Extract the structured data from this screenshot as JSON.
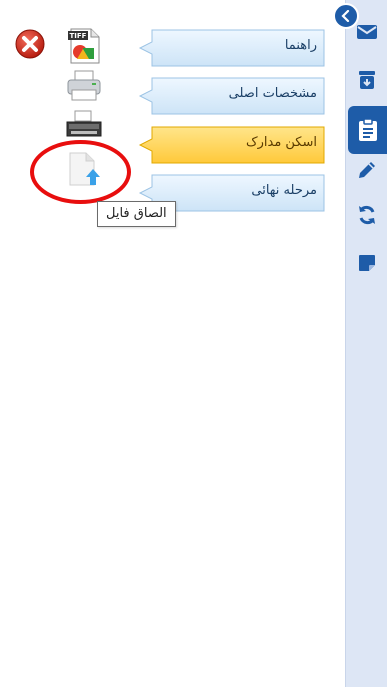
{
  "steps": [
    {
      "label": "راهنما",
      "state": "normal"
    },
    {
      "label": "مشخصات اصلی",
      "state": "normal"
    },
    {
      "label": "اسکن مدارک",
      "state": "active"
    },
    {
      "label": "مرحله نهائی",
      "state": "normal"
    }
  ],
  "tools": {
    "tiff_label": "TIFF",
    "tooltip": "الصاق فایل"
  },
  "sidebar": {
    "icons": [
      "mail-icon",
      "archive-download-icon",
      "clipboard-icon",
      "pencil-icon",
      "sync-icon",
      "note-icon"
    ],
    "active_index": 2
  },
  "colors": {
    "sidebar_bg": "#dde6f5",
    "accent": "#1e5ca8",
    "step_normal": "#d7ebfb",
    "step_active": "#ffd45c",
    "annotation": "#e80e0e"
  }
}
